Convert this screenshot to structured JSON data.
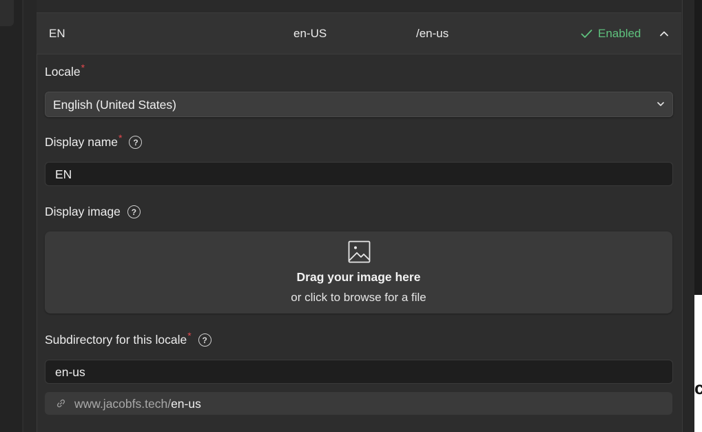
{
  "locale_row": {
    "display_name": "EN",
    "code": "en-US",
    "path": "/en-us",
    "status": "Enabled",
    "status_color": "#5fc27e"
  },
  "form": {
    "locale": {
      "label": "Locale",
      "required_mark": "*",
      "value": "English (United States)"
    },
    "display_name": {
      "label": "Display name",
      "required_mark": "*",
      "help": "?",
      "value": "EN"
    },
    "display_image": {
      "label": "Display image",
      "help": "?",
      "drop_title": "Drag your image here",
      "drop_subtitle": "or click to browse for a file"
    },
    "subdirectory": {
      "label": "Subdirectory for this locale",
      "required_mark": "*",
      "help": "?",
      "value": "en-us"
    },
    "url_preview": {
      "base": "www.jacobfs.tech/",
      "slug": "en-us"
    }
  },
  "edge_fragment": "c"
}
